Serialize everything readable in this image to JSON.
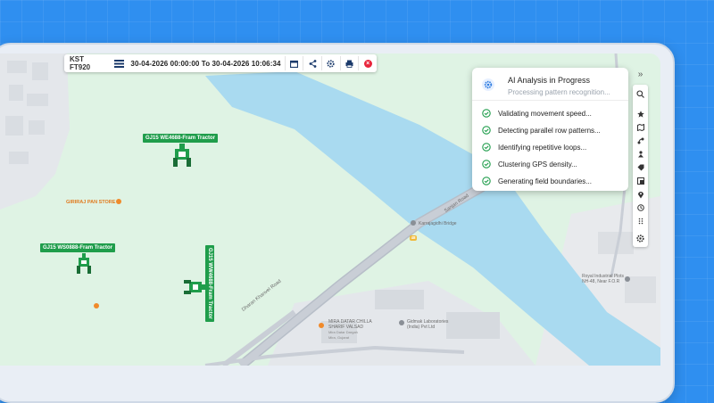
{
  "toolbar": {
    "vehicle": "KST FT920",
    "date_range": "30-04-2026 00:00:00 To 30-04-2026 10:06:34",
    "icons": [
      "menu-icon",
      "calendar-icon",
      "share-icon",
      "settings-icon",
      "print-icon",
      "close-icon"
    ]
  },
  "ai_panel": {
    "title": "AI Analysis in Progress",
    "subtitle": "Processing pattern recognition...",
    "steps": [
      "Validating movement speed...",
      "Detecting parallel row patterns...",
      "Identifying repetitive loops...",
      "Clustering GPS density...",
      "Generating field boundaries..."
    ],
    "accent": "#2f7de1",
    "check_color": "#1f9d4b"
  },
  "map": {
    "tractors": [
      "GJ15 WE4688-Fram Tractor",
      "GJ15 WS0888-Fram Tractor",
      "GJ15 WW4688-Fram Tractor"
    ],
    "places": {
      "giriraj": "GIRIRAJ PAN STORE",
      "bridge": "Karrajagidhi Bridge",
      "road_badge": "48",
      "road_upper": "Sanjan Road",
      "road_lower": "Dharan Khanvel Road",
      "mira_line1": "MIRA DATAR CHILLA",
      "mira_line2": "SHARIF VALSAD",
      "mira_line3": "Mira Datar Dargah",
      "mira_line4": "Mira, Gujarat",
      "gidmak_line1": "Gidmak Laboratories",
      "gidmak_line2": "(India) Pvt Ltd",
      "royal_line1": "Royal Industrial Plots",
      "royal_line2": "NH-48, Near F.O.R"
    },
    "colors": {
      "land": "#dff3e4",
      "water": "#a9daf0",
      "road": "#c9ced6",
      "built": "#e5e7ea",
      "tractor_green": "#1f9d4b",
      "poi_orange": "#e07a1e"
    }
  }
}
